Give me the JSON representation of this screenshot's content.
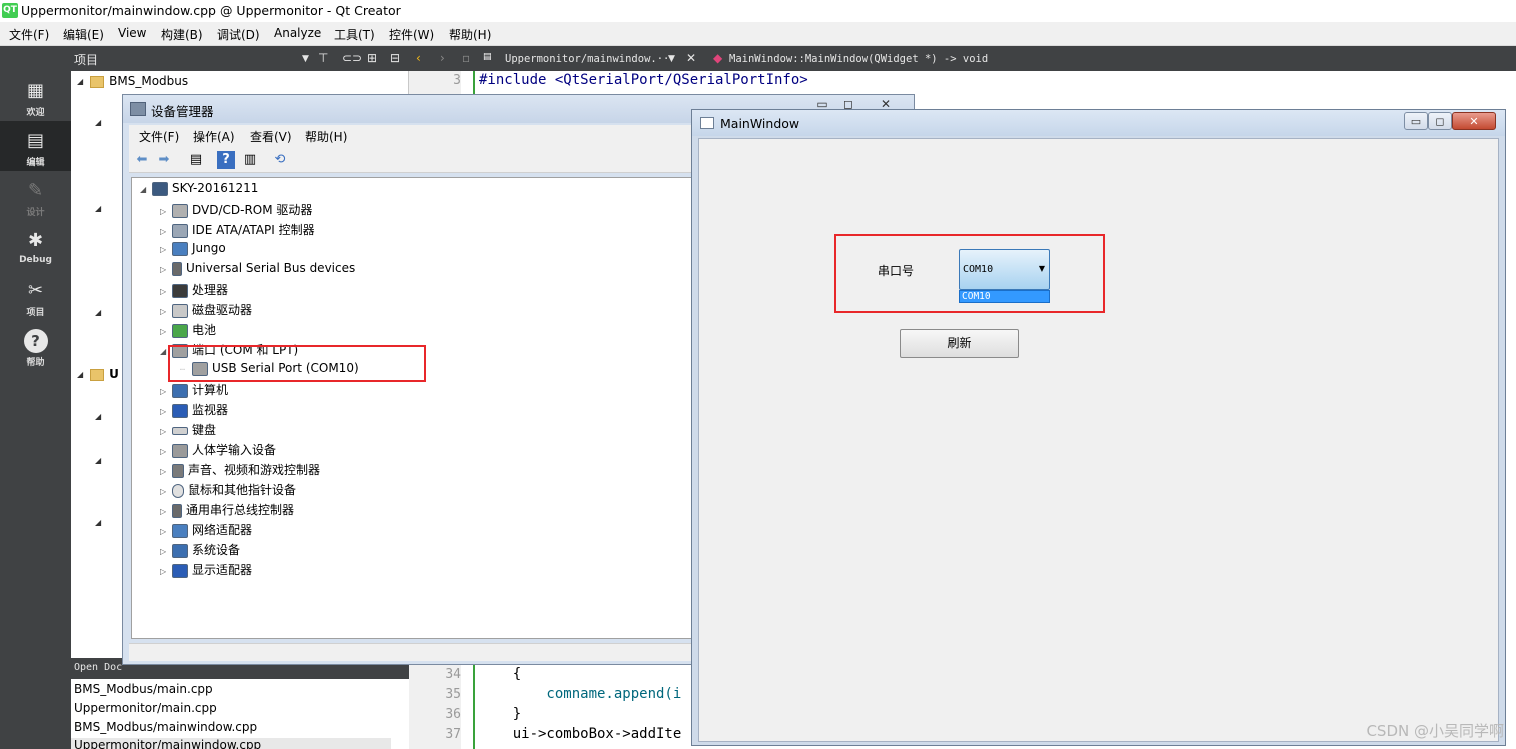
{
  "qt": {
    "logo": "QT",
    "title": "Uppermonitor/mainwindow.cpp @ Uppermonitor - Qt Creator",
    "menu": [
      "文件(F)",
      "编辑(E)",
      "View",
      "构建(B)",
      "调试(D)",
      "Analyze",
      "工具(T)",
      "控件(W)",
      "帮助(H)"
    ],
    "toolbar": {
      "project_label": "项目",
      "file_tab": "Uppermonitor/mainwindow.···",
      "function": "MainWindow::MainWindow(QWidget *) -> void"
    },
    "modes": [
      {
        "label": "欢迎",
        "icon": "grid-icon"
      },
      {
        "label": "编辑",
        "icon": "edit-icon"
      },
      {
        "label": "设计",
        "icon": "pen-icon"
      },
      {
        "label": "Debug",
        "icon": "bug-icon"
      },
      {
        "label": "项目",
        "icon": "wrench-icon"
      },
      {
        "label": "帮助",
        "icon": "help-icon"
      }
    ],
    "project_tree": {
      "root": "BMS_Modbus",
      "second_root": "U"
    },
    "open_docs": {
      "header": "Open Doc",
      "items": [
        "BMS_Modbus/main.cpp",
        "Uppermonitor/main.cpp",
        "BMS_Modbus/mainwindow.cpp",
        "Uppermonitor/mainwindow.cpp"
      ]
    },
    "editor": {
      "top_line_number": "3",
      "top_line_code": "#include <QtSerialPort/QSerialPortInfo>",
      "lines": [
        {
          "n": "34",
          "code": "    {"
        },
        {
          "n": "35",
          "code": "        comname.append(i"
        },
        {
          "n": "36",
          "code": "    }"
        },
        {
          "n": "37",
          "code": "    ui->comboBox->addIte"
        }
      ]
    }
  },
  "device_manager": {
    "title": "设备管理器",
    "controls": [
      "▭",
      "◻",
      "✕"
    ],
    "menu": [
      "文件(F)",
      "操作(A)",
      "查看(V)",
      "帮助(H)"
    ],
    "root": "SKY-20161211",
    "items": [
      "DVD/CD-ROM 驱动器",
      "IDE ATA/ATAPI 控制器",
      "Jungo",
      "Universal Serial Bus devices",
      "处理器",
      "磁盘驱动器",
      "电池",
      "端口 (COM 和 LPT)",
      "USB Serial Port (COM10)",
      "计算机",
      "监视器",
      "键盘",
      "人体学输入设备",
      "声音、视频和游戏控制器",
      "鼠标和其他指针设备",
      "通用串行总线控制器",
      "网络适配器",
      "系统设备",
      "显示适配器"
    ]
  },
  "main_window": {
    "title": "MainWindow",
    "controls": [
      "▭",
      "◻",
      "✕"
    ],
    "port_label": "串口号",
    "combo_value": "COM10",
    "combo_options": [
      "COM10"
    ],
    "refresh_button": "刷新"
  },
  "watermark": "CSDN @小吴同学啊"
}
